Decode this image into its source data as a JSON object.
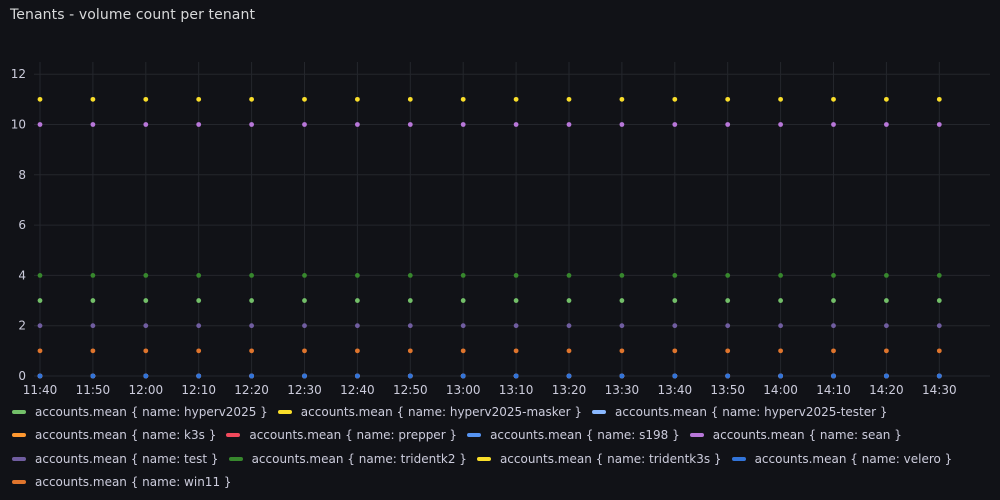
{
  "panel": {
    "title": "Tenants - volume count per tenant"
  },
  "chart_data": {
    "type": "scatter",
    "x": [
      "11:40",
      "11:50",
      "12:00",
      "12:10",
      "12:20",
      "12:30",
      "12:40",
      "12:50",
      "13:00",
      "13:10",
      "13:20",
      "13:30",
      "13:40",
      "13:50",
      "14:00",
      "14:10",
      "14:20",
      "14:30"
    ],
    "xticks": [
      "11:40",
      "11:50",
      "12:00",
      "12:10",
      "12:20",
      "12:30",
      "12:40",
      "12:50",
      "13:00",
      "13:10",
      "13:20",
      "13:30",
      "13:40",
      "13:50",
      "14:00",
      "14:10",
      "14:20",
      "14:30"
    ],
    "yticks": [
      0,
      2,
      4,
      6,
      8,
      10,
      12
    ],
    "ylim": [
      0,
      13
    ],
    "grid": true,
    "legend_position": "bottom",
    "series": [
      {
        "name": "accounts.mean { name: hyperv2025 }",
        "color": "#73bf69",
        "value": 3
      },
      {
        "name": "accounts.mean { name: hyperv2025-masker }",
        "color": "#fade2a",
        "value": 0
      },
      {
        "name": "accounts.mean { name: hyperv2025-tester }",
        "color": "#8ab8ff",
        "value": 0
      },
      {
        "name": "accounts.mean { name: k3s }",
        "color": "#ff9830",
        "value": 0
      },
      {
        "name": "accounts.mean { name: prepper }",
        "color": "#f2495c",
        "value": 0
      },
      {
        "name": "accounts.mean { name: s198 }",
        "color": "#5794f2",
        "value": 0
      },
      {
        "name": "accounts.mean { name: sean }",
        "color": "#b877d9",
        "value": 10
      },
      {
        "name": "accounts.mean { name: test }",
        "color": "#705da0",
        "value": 2
      },
      {
        "name": "accounts.mean { name: tridentk2 }",
        "color": "#37872d",
        "value": 4
      },
      {
        "name": "accounts.mean { name: tridentk3s }",
        "color": "#fade2a",
        "value": 11
      },
      {
        "name": "accounts.mean { name: velero }",
        "color": "#3274d9",
        "value": 0
      },
      {
        "name": "accounts.mean { name: win11 }",
        "color": "#e0752d",
        "value": 1
      }
    ]
  },
  "legend_rows": [
    [
      0,
      1,
      2
    ],
    [
      3,
      4,
      5,
      6
    ],
    [
      7,
      8,
      9,
      10
    ],
    [
      11
    ]
  ]
}
